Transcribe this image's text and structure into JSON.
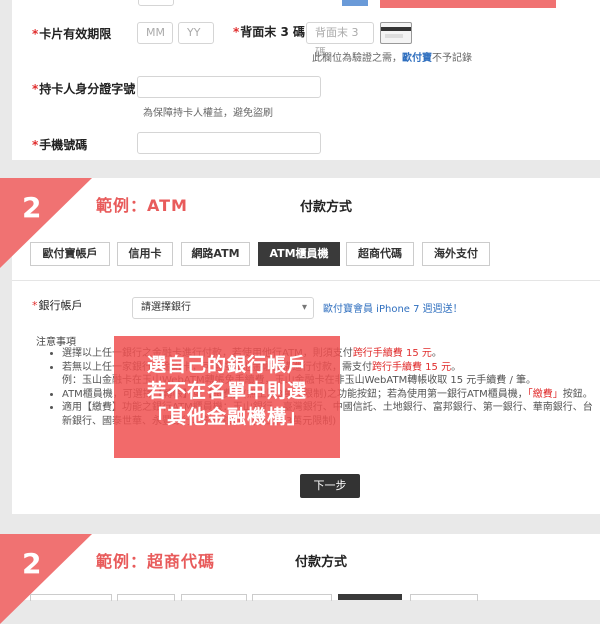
{
  "card_form": {
    "expiry_label": "卡片有效期限",
    "month_placeholder": "MM",
    "year_placeholder": "YY",
    "cvc_label": "背面末 3 碼",
    "cvc_placeholder": "背面末 3 碼",
    "cvc_hint_before": "此欄位為驗證之需，",
    "cvc_hint_link": "歐付寶",
    "cvc_hint_after": "不予記錄",
    "id_label": "持卡人身分證字號",
    "id_hint": "為保障持卡人權益，避免盜刷",
    "phone_label": "手機號碼"
  },
  "atm_section": {
    "step": "2",
    "example_title": "範例：ATM",
    "title": "付款方式",
    "tabs": [
      "歐付寶帳戶",
      "信用卡",
      "網路ATM",
      "ATM櫃員機",
      "超商代碼",
      "海外支付"
    ],
    "active_tab": "ATM櫃員機",
    "bank_label": "銀行帳戶",
    "bank_select": "請選擇銀行",
    "promo_link": "歐付寶會員 iPhone 7 週週送！",
    "notes_title": "注意事項",
    "notes": [
      {
        "text": "選擇以上任一銀行之金融卡進行付款，若使用他行ATM，則須支付",
        "em": "跨行手續費 15 元",
        "tail": "。"
      },
      {
        "text": "若無以上任一家銀行之金融卡，可選擇其他金融機構進行付款，需支付",
        "em": "跨行手續費 15 元",
        "tail": "。"
      },
      {
        "text": "例：玉山金融卡在玉山WebATM轉帳免手續費，玉山金融卡在非玉山WebATM轉帳收取 15 元手續費 / 筆。",
        "em": "",
        "tail": ""
      },
      {
        "text": "ATM櫃員機，可選擇【轉帳】或【繳費】(無上限3萬元限制)之功能按鈕；若為使用第一銀行ATM櫃員機，",
        "em": "「繳費」",
        "tail": "按鈕。"
      },
      {
        "text": "適用【繳費】功能之銀行ATM櫃員機：玉山銀行、臺灣銀行、中國信託、土地銀行、富邦銀行、第一銀行、華南銀行、台新銀行、國泰世華、永豐銀行、彰化銀行。(無上限3萬元限制)",
        "em": "",
        "tail": ""
      }
    ],
    "overlay_lines": [
      "選自己的銀行帳戶",
      "若不在名單中則選",
      "「其他金融機構」"
    ],
    "next_button": "下一步"
  },
  "store_section": {
    "step": "2",
    "example_title": "範例：超商代碼",
    "title": "付款方式"
  },
  "colors": {
    "accent_red": "#e02d2d",
    "step_pink": "#f07272",
    "link_blue": "#2f6fbf",
    "active_tab": "#3a3a3a"
  }
}
